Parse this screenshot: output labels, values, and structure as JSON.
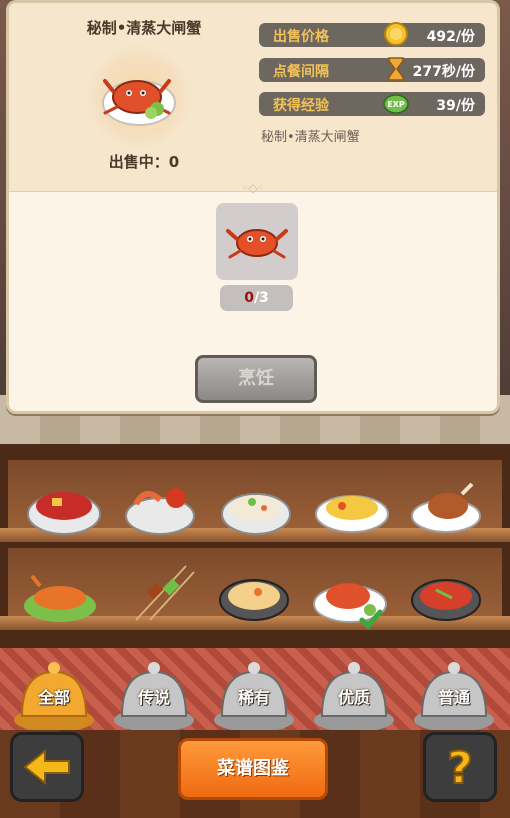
{
  "popup": {
    "dish_name": "秘制•清蒸大闸蟹",
    "selling_label": "出售中：0",
    "stats": [
      {
        "label": "出售价格",
        "value": "492/份",
        "icon": "gold-coin-icon"
      },
      {
        "label": "点餐间隔",
        "value": "277秒/份",
        "icon": "hourglass-icon"
      },
      {
        "label": "获得经验",
        "value": "39/份",
        "icon": "exp-icon"
      }
    ],
    "recipe_subtitle": "秘制•清蒸大闸蟹",
    "ingredient": {
      "icon": "crab-icon",
      "have": "0",
      "need": "/3"
    },
    "cook_button": "烹饪"
  },
  "shelf": {
    "row1": [
      "meat-stew-bowl",
      "shrimp-crab-bowl",
      "veg-soup-bowl",
      "egg-scramble-plate",
      "roast-chicken-plate"
    ],
    "row2": [
      "lobster-platter",
      "skewers",
      "soup-pot",
      "steamed-crab-plate-selected",
      "spicy-stew-pot"
    ]
  },
  "filters": [
    "全部",
    "传说",
    "稀有",
    "优质",
    "普通"
  ],
  "bottom": {
    "recipe_book": "菜谱图鉴",
    "back_icon": "arrow-left-icon",
    "help_icon": "question-icon"
  },
  "colors": {
    "stat_label": "#f2c257",
    "stat_bg": "#6e6760",
    "accent_orange": "#f06a12",
    "ingredient_have": "#9a1010"
  }
}
